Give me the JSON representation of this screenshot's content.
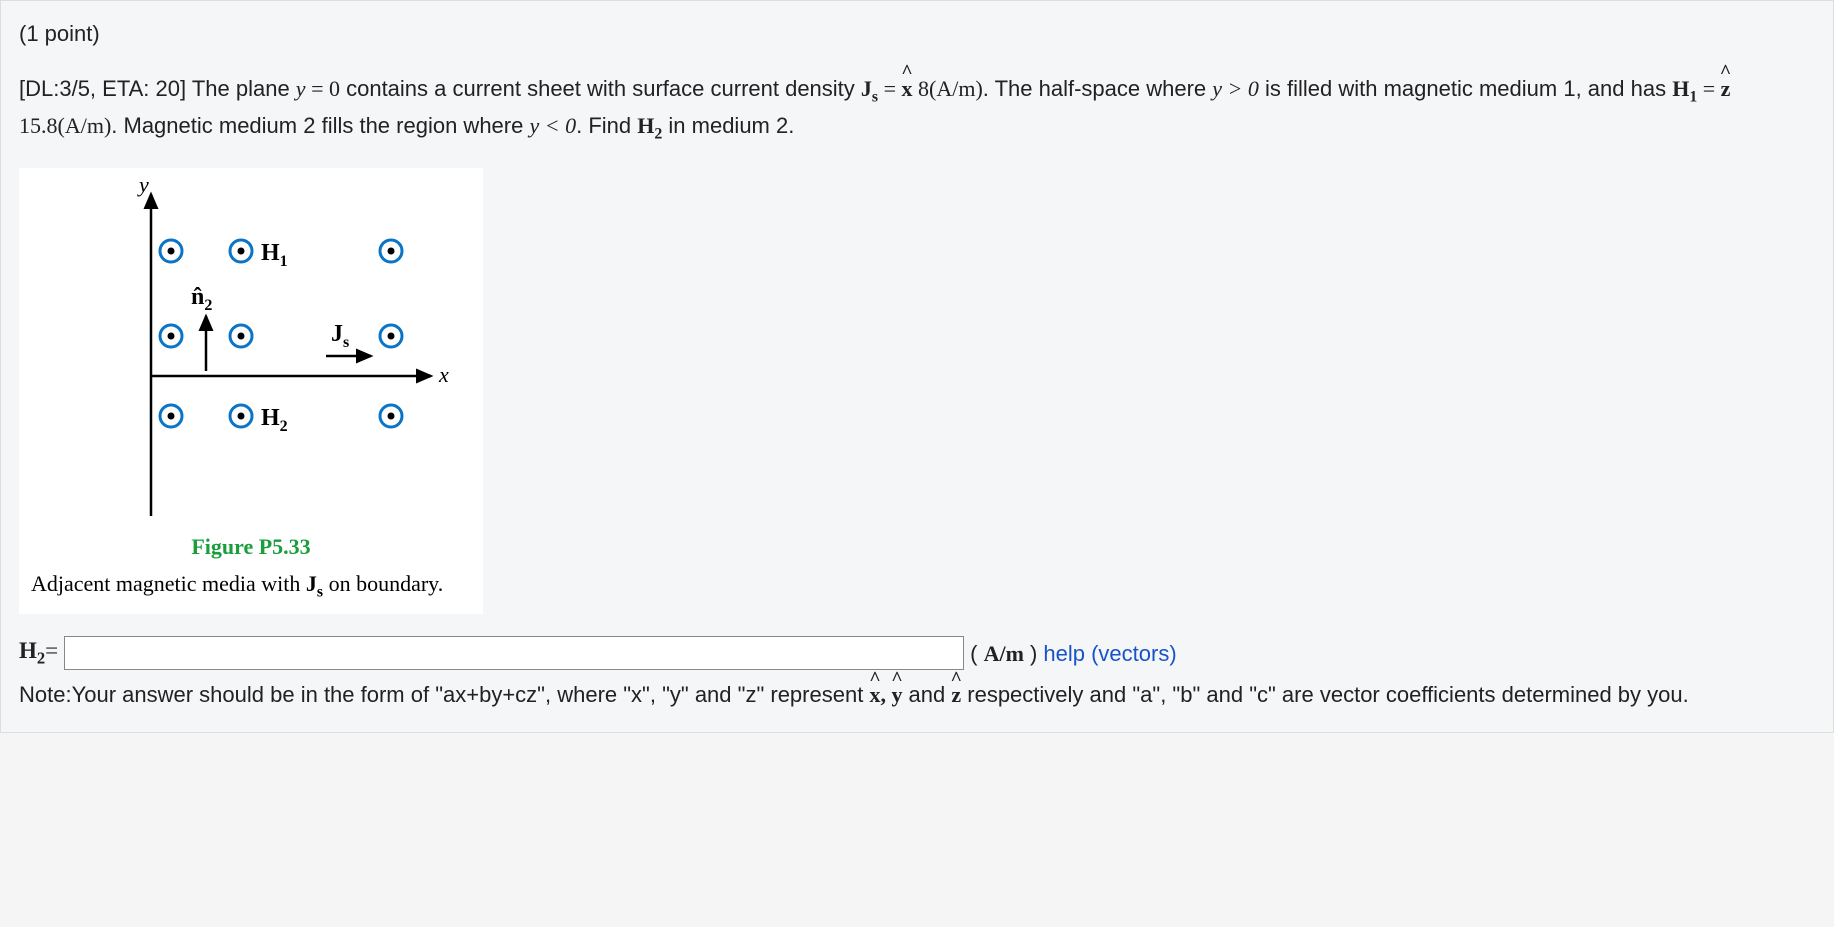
{
  "points": "(1 point)",
  "question": {
    "prefix": "[DL:3/5, ETA: 20] The plane ",
    "eq1_lhs": "y",
    "eq1_rhs": " = 0",
    "part2": " contains a current sheet with surface current density ",
    "Js_sym": "J",
    "Js_sub": "s",
    "eq2_mid": " = ",
    "xhat": "x",
    "Js_val": " 8(A/m)",
    "part3": ". The half-space where ",
    "cond1": "y > 0",
    "part4": " is filled with magnetic medium 1, and has ",
    "H1_sym": "H",
    "H1_sub": "1",
    "eq3_mid": " = ",
    "zhat": "z",
    "H1_val": " 15.8(A/m)",
    "part5": ". Magnetic medium 2 fills the region where ",
    "cond2": "y < 0",
    "part6": ". Find ",
    "H2_sym": "H",
    "H2_sub": "2",
    "part7": " in medium 2."
  },
  "figure": {
    "y_label": "y",
    "x_label": "x",
    "H1_label": "H",
    "H1_sub": "1",
    "H2_label": "H",
    "H2_sub": "2",
    "n2_label": "n",
    "n2_sub": "2",
    "Js_label": "J",
    "Js_sub": "s",
    "title": "Figure P5.33",
    "caption_pre": "Adjacent magnetic media with ",
    "caption_J": "J",
    "caption_Jsub": "s",
    "caption_post": " on boundary."
  },
  "answer": {
    "label_H": "H",
    "label_sub": "2",
    "label_eq": "=",
    "value": "",
    "unit_pre": "( ",
    "unit": "A/m",
    "unit_post": " )",
    "help": "help (vectors)"
  },
  "note": {
    "pre": "Note:Your answer should be in the form of \"ax+by+cz\", where \"x\", \"y\" and \"z\" represent ",
    "x": "x",
    "comma1": ", ",
    "y": "y",
    "and1": " and ",
    "z": "z",
    "post": " respectively and \"a\", \"b\" and \"c\" are vector coefficients determined by you."
  }
}
